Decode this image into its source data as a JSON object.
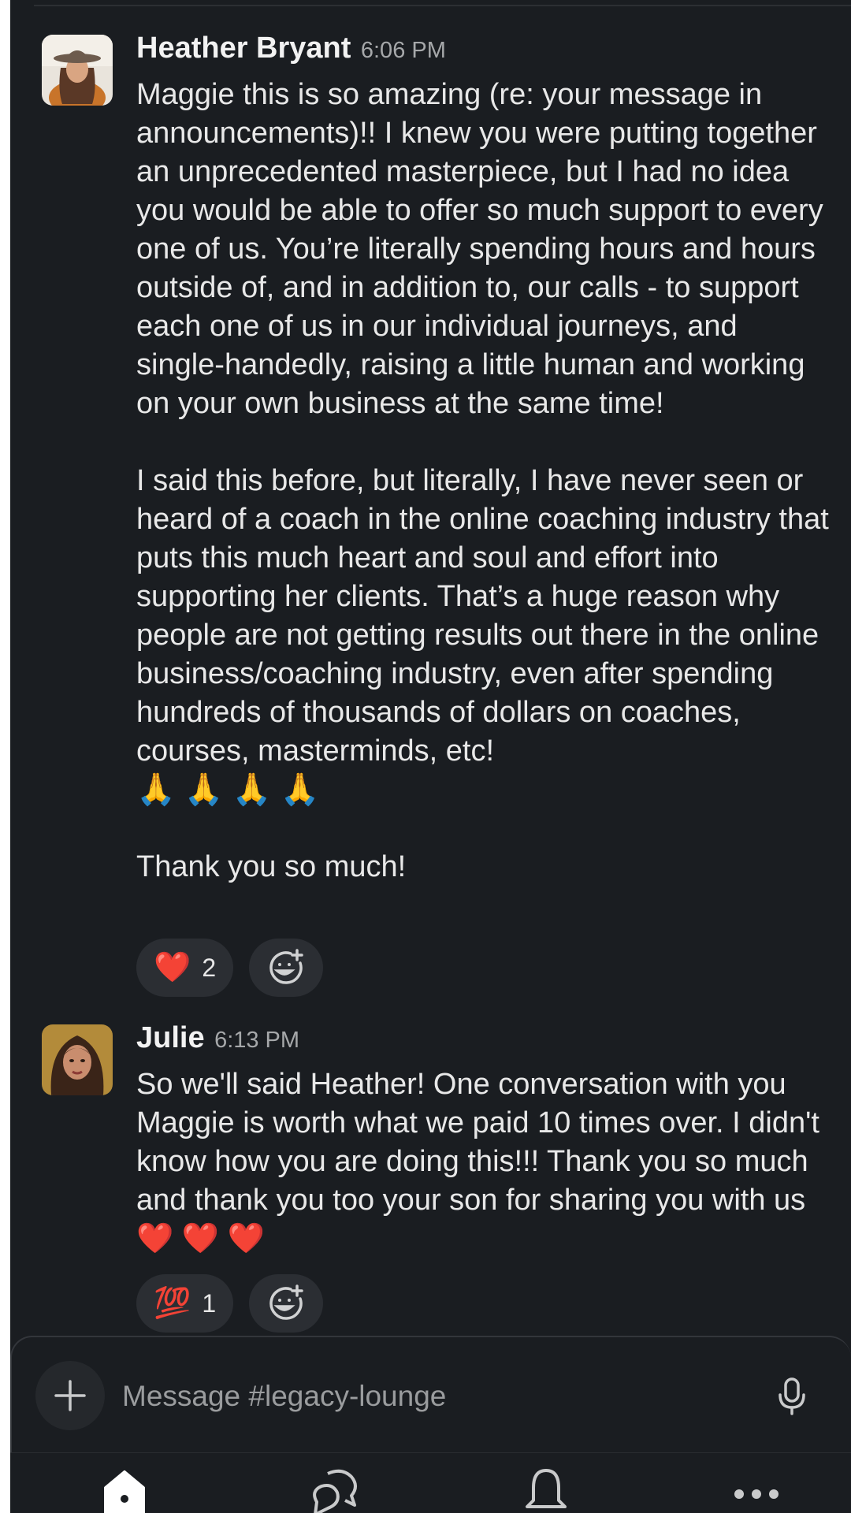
{
  "channel": "legacy-lounge",
  "messages": [
    {
      "author": "Heather Bryant",
      "time": "6:06 PM",
      "paragraphs": [
        "Maggie this is so amazing (re: your message in announcements)!!  I knew you were putting together an unprecedented masterpiece, but I had no idea you would be able to offer so much support to every one of us. You’re literally spending hours and hours outside of, and in addition to, our calls - to support each one of us in our individual journeys, and single-handedly, raising a little human and working on your own business at the same time!",
        "I said this before, but literally, I have never seen or heard of a coach in the online coaching industry that puts this much heart and soul and effort into supporting her clients. That’s a huge reason why people are not getting results out there in the online business/coaching industry, even after spending hundreds of thousands of dollars on coaches, courses, masterminds, etc!",
        "🙏 🙏 🙏 🙏",
        "Thank you so much!"
      ],
      "reaction": {
        "emoji": "❤️",
        "count": "2"
      }
    },
    {
      "author": "Julie",
      "time": "6:13 PM",
      "paragraphs": [
        "So we'll said Heather! One conversation with you Maggie is worth what we paid 10 times over. I didn't know how you are doing this!!! Thank you so much and thank you too your son for sharing you with us❤️ ❤️ ❤️"
      ],
      "reaction": {
        "emoji": "💯",
        "count": "1"
      }
    }
  ],
  "composer": {
    "placeholder": "Message #legacy-lounge"
  },
  "tabs": [
    {
      "name": "home",
      "icon": "home-icon",
      "active": true
    },
    {
      "name": "dms",
      "icon": "chat-bubbles-icon",
      "active": false
    },
    {
      "name": "activity",
      "icon": "bell-icon",
      "active": false
    },
    {
      "name": "more",
      "icon": "more-dots-icon",
      "active": false
    }
  ],
  "colors": {
    "background": "#1a1d21",
    "text": "#e8e8e8",
    "muted": "#a6a8aa",
    "pill": "#2b2e33"
  }
}
